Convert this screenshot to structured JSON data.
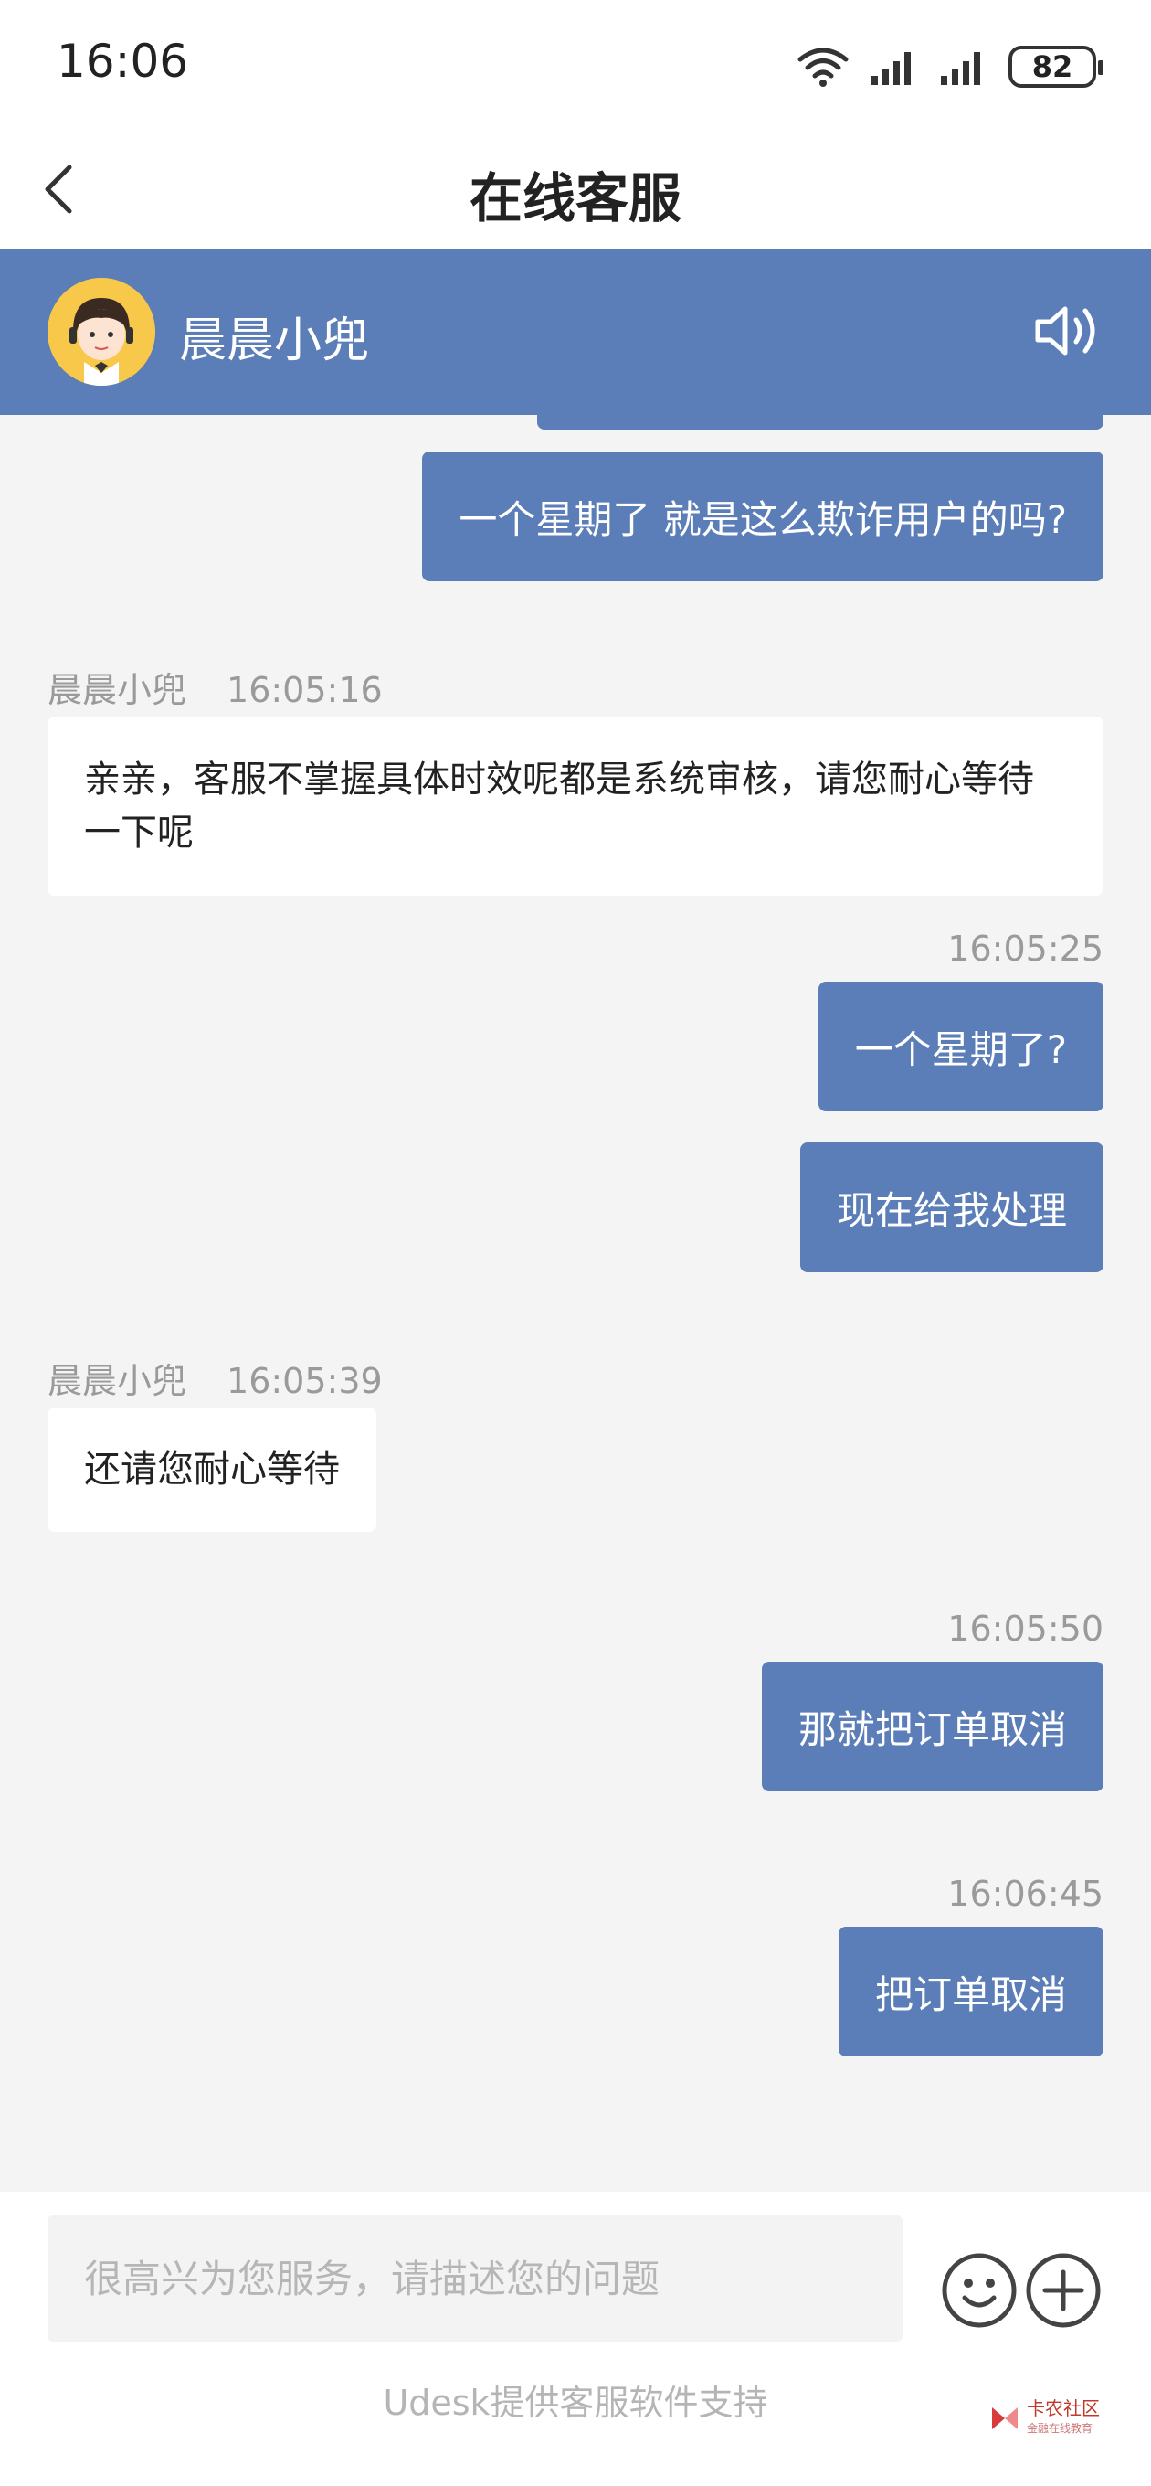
{
  "status_bar": {
    "time": "16:06",
    "battery": "82",
    "icons": [
      "wifi-icon",
      "signal-icon",
      "signal-icon",
      "battery-icon"
    ]
  },
  "header": {
    "title": "在线客服",
    "back_icon": "chevron-left-icon"
  },
  "agent_bar": {
    "name": "晨晨小兜",
    "avatar_icon": "agent-avatar",
    "speaker_icon": "speaker-icon",
    "color": "#5b7db8"
  },
  "messages": [
    {
      "from": "user",
      "text": "一个星期了 就是这么欺诈用户的吗?"
    },
    {
      "from": "agent",
      "sender": "晨晨小兜",
      "time": "16:05:16",
      "text": "亲亲，客服不掌握具体时效呢都是系统审核，请您耐心等待一下呢"
    },
    {
      "from": "user",
      "time": "16:05:25",
      "text": "一个星期了?"
    },
    {
      "from": "user",
      "text": "现在给我处理"
    },
    {
      "from": "agent",
      "sender": "晨晨小兜",
      "time": "16:05:39",
      "text": "还请您耐心等待"
    },
    {
      "from": "user",
      "time": "16:05:50",
      "text": "那就把订单取消"
    },
    {
      "from": "user",
      "time": "16:06:45",
      "text": "把订单取消"
    }
  ],
  "composer": {
    "placeholder": "很高兴为您服务，请描述您的问题",
    "emoji_icon": "emoji-icon",
    "plus_icon": "plus-icon",
    "powered_by": "Udesk提供客服软件支持"
  },
  "watermark": {
    "text": "卡农社区",
    "subtext": "金融在线教育"
  },
  "colors": {
    "user_bubble": "#5b7db8",
    "agent_bubble": "#ffffff",
    "chat_bg": "#f4f4f4"
  }
}
